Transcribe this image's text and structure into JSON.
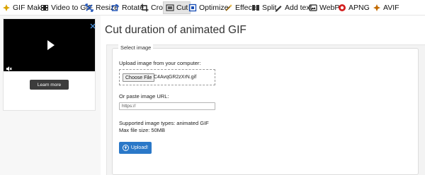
{
  "toolbar": {
    "items": [
      {
        "label": "GIF Maker",
        "icon": "gif-maker-icon"
      },
      {
        "label": "Video to GIF",
        "icon": "video-icon"
      },
      {
        "label": "Resize",
        "icon": "resize-icon"
      },
      {
        "label": "Rotate",
        "icon": "rotate-icon"
      },
      {
        "label": "Crop",
        "icon": "crop-icon"
      },
      {
        "label": "Cut",
        "icon": "cut-icon",
        "active": true
      },
      {
        "label": "Optimize",
        "icon": "optimize-icon"
      },
      {
        "label": "Effects",
        "icon": "effects-icon"
      },
      {
        "label": "Split",
        "icon": "split-icon"
      },
      {
        "label": "Add text",
        "icon": "add-text-icon"
      },
      {
        "label": "WebP",
        "icon": "webp-icon"
      },
      {
        "label": "APNG",
        "icon": "apng-icon"
      },
      {
        "label": "AVIF",
        "icon": "avif-icon"
      }
    ]
  },
  "ad": {
    "button_label": "Learn more"
  },
  "main": {
    "title": "Cut duration of animated GIF",
    "form": {
      "legend": "Select image",
      "upload_label": "Upload image from your computer:",
      "choose_button": "Choose File",
      "filename": "C4AvqGR2zXrN.gif",
      "url_label": "Or paste image URL:",
      "url_placeholder": "https://",
      "supported_text": "Supported image types: animated GIF",
      "max_size_text": "Max file size: 50MB",
      "upload_button": "Upload!"
    }
  },
  "colors": {
    "accent": "#2a78c8",
    "panel_bg": "#f3f3f3",
    "video_bg": "#000000"
  }
}
